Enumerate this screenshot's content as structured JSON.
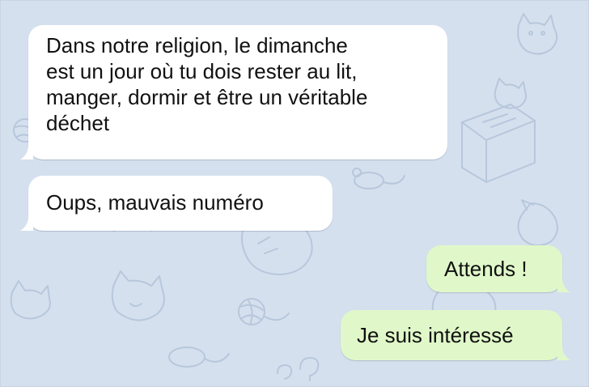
{
  "colors": {
    "wallpaper": "#d5e0ee",
    "doodle": "#b7c7dc",
    "incoming_bubble": "#ffffff",
    "outgoing_bubble": "#e0f8c9",
    "text": "#111111"
  },
  "wallpaper_icons": [
    "cat-icon",
    "yarn-ball-icon",
    "mouse-icon",
    "box-icon",
    "collar-icon",
    "question-mark-icon"
  ],
  "messages": [
    {
      "direction": "incoming",
      "lines": [
        "Dans notre religion, le dimanche",
        "est un jour où tu dois rester au lit,",
        "manger, dormir et être un véritable",
        "déchet"
      ]
    },
    {
      "direction": "incoming",
      "lines": [
        "Oups, mauvais numéro"
      ]
    },
    {
      "direction": "outgoing",
      "lines": [
        "Attends !"
      ]
    },
    {
      "direction": "outgoing",
      "lines": [
        "Je suis intéressé"
      ]
    }
  ]
}
